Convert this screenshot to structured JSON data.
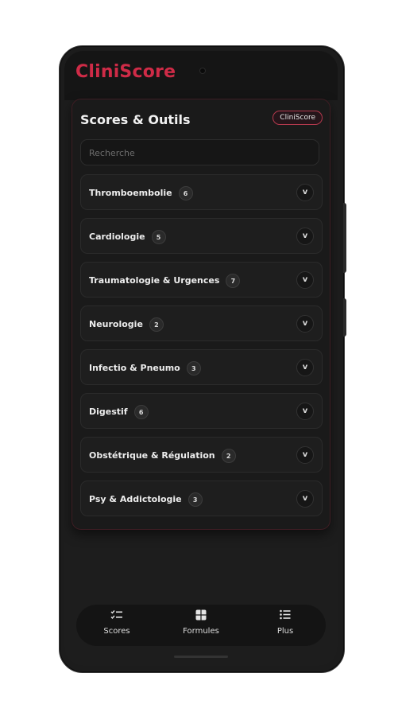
{
  "app": {
    "title": "CliniScore"
  },
  "panel": {
    "title": "Scores & Outils",
    "badge": "CliniScore",
    "search_placeholder": "Recherche"
  },
  "categories": [
    {
      "label": "Thromboembolie",
      "count": "6",
      "toggle": "v"
    },
    {
      "label": "Cardiologie",
      "count": "5",
      "toggle": "v"
    },
    {
      "label": "Traumatologie & Urgences",
      "count": "7",
      "toggle": "v"
    },
    {
      "label": "Neurologie",
      "count": "2",
      "toggle": "v"
    },
    {
      "label": "Infectio & Pneumo",
      "count": "3",
      "toggle": "v"
    },
    {
      "label": "Digestif",
      "count": "6",
      "toggle": "v"
    },
    {
      "label": "Obstétrique & Régulation",
      "count": "2",
      "toggle": "v"
    },
    {
      "label": "Psy & Addictologie",
      "count": "3",
      "toggle": "v"
    }
  ],
  "nav": [
    {
      "label": "Scores",
      "icon": "checklist-icon"
    },
    {
      "label": "Formules",
      "icon": "grid-icon"
    },
    {
      "label": "Plus",
      "icon": "list-icon"
    }
  ],
  "colors": {
    "accent": "#cf2b47",
    "background": "#1d1d1d",
    "panel_border": "#3d1d23"
  }
}
